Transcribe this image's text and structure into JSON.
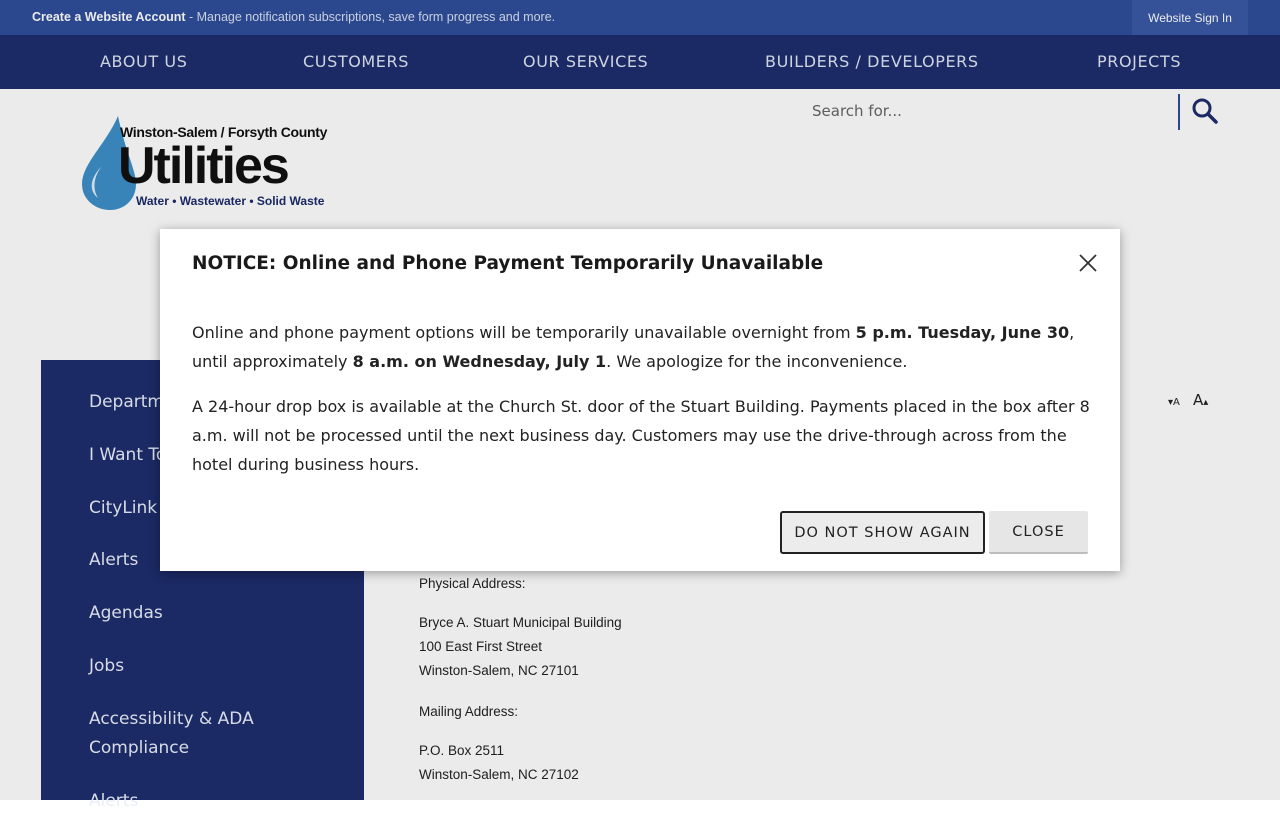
{
  "topbar": {
    "create_account_link": "Create a Website Account",
    "create_account_desc": " - Manage notification subscriptions, save form progress and more.",
    "sign_in": "Website Sign In"
  },
  "main_nav": [
    "ABOUT US",
    "CUSTOMERS",
    "OUR SERVICES",
    "BUILDERS / DEVELOPERS",
    "PROJECTS"
  ],
  "logo": {
    "line1": "Winston-Salem / Forsyth County",
    "line2": "Utilities",
    "line3": "Water • Wastewater • Solid Waste"
  },
  "search": {
    "placeholder": "Search for..."
  },
  "sidebar": {
    "items": [
      "Departments",
      "I Want To...",
      "CityLink",
      "Alerts",
      "Agendas",
      "Jobs",
      "Accessibility & ADA",
      "Compliance",
      "Alerts"
    ]
  },
  "font_size_controls": {
    "decrease": "A",
    "increase": "A"
  },
  "content": {
    "physical_label": "Physical Address:",
    "physical_line1": "Bryce A. Stuart Municipal Building",
    "physical_line2": "100 East First Street",
    "physical_line3": "Winston-Salem, NC 27101",
    "mailing_label": "Mailing Address:",
    "mailing_line1": "P.O. Box 2511",
    "mailing_line2": "Winston-Salem, NC 27102"
  },
  "modal": {
    "title": "NOTICE: Online and Phone Payment Temporarily Unavailable",
    "p1_a": "Online and phone payment options will be temporarily unavailable overnight from ",
    "p1_b": "5 p.m. Tuesday, June 30",
    "p1_c": ", until approximately ",
    "p1_d": "8 a.m. on Wednesday, July 1",
    "p1_e": ". We apologize for the inconvenience.",
    "p2": "A 24-hour drop box is available at the Church St. door of the Stuart Building. Payments placed in the box after 8 a.m. will not be processed until the next business day. Customers may use the drive-through across from the hotel during business hours.",
    "btn_do_not_show": "DO NOT SHOW AGAIN",
    "btn_close": "CLOSE"
  },
  "colors": {
    "topbar": "#2f4f9b",
    "nav": "#1e2d6d",
    "sidebar": "#1e2d6d",
    "logo_drop": "#3d8fc7"
  }
}
